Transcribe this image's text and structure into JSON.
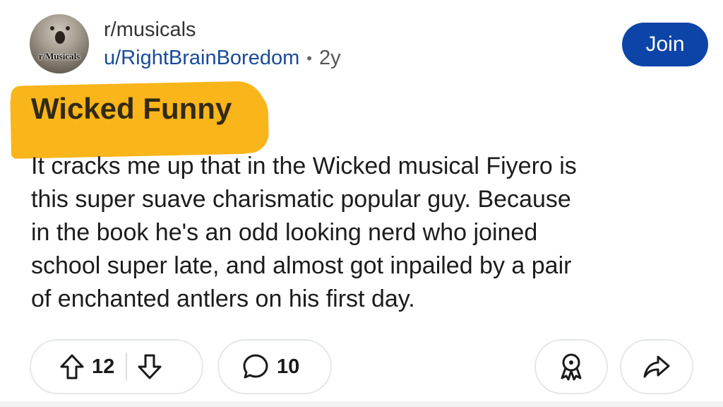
{
  "post": {
    "avatar_label": "r/Musicals",
    "subreddit": "r/musicals",
    "author": "u/RightBrainBoredom",
    "separator": "•",
    "age": "2y",
    "join_label": "Join",
    "title": "Wicked Funny",
    "body": "It cracks me up that in the Wicked musical Fiyero is\nthis super suave charismatic popular guy. Because\nin the book he's an odd looking nerd who joined\nschool super late, and almost got inpailed by a pair\nof enchanted antlers on his first day."
  },
  "actions": {
    "score": "12",
    "comments": "10",
    "icons": [
      "upvote-arrow-icon",
      "downvote-arrow-icon",
      "comment-bubble-icon",
      "award-icon",
      "share-arrow-icon"
    ]
  },
  "colors": {
    "join_bg": "#0d44a8",
    "author_link": "#1a4a9a",
    "title_highlight": "#f9b51a"
  }
}
